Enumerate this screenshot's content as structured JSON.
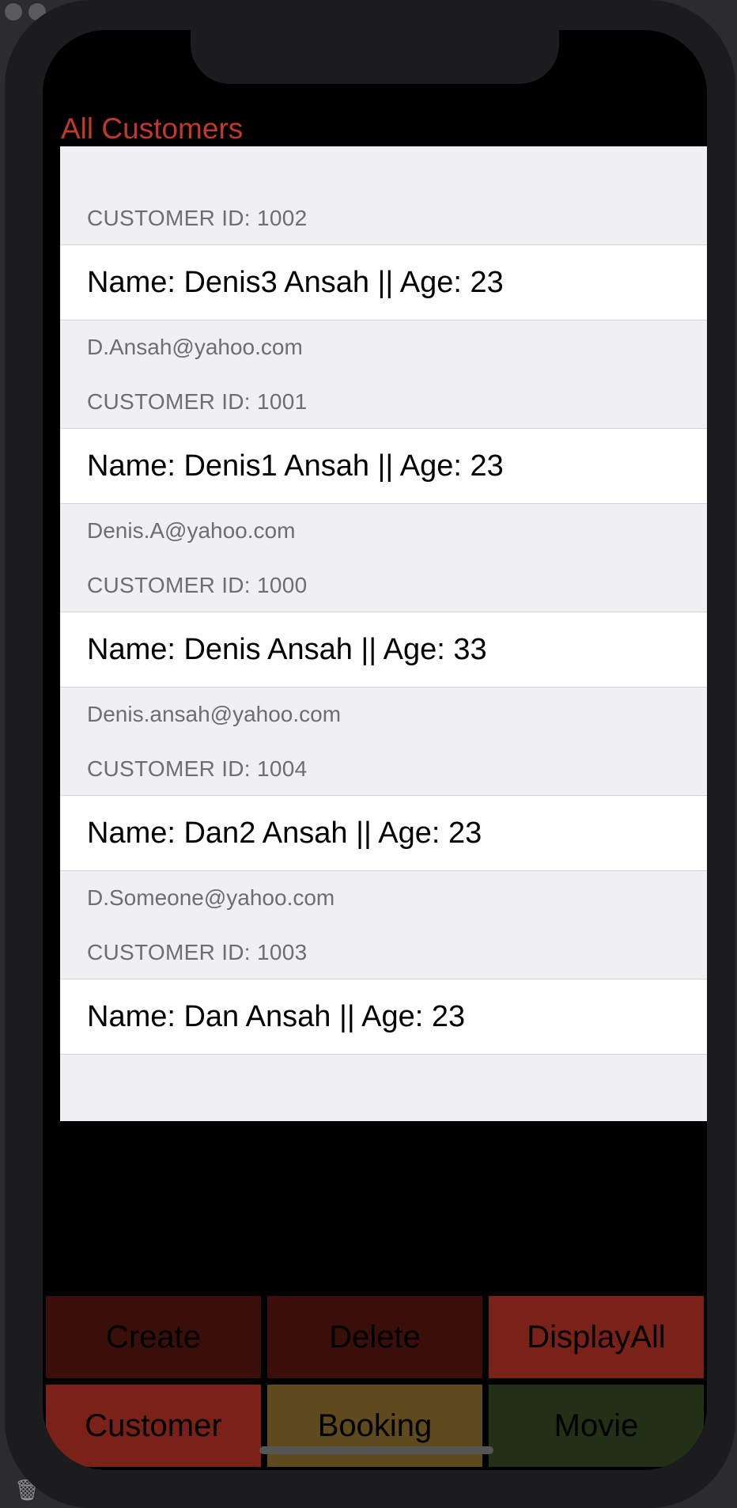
{
  "nav": {
    "title": "All Customers"
  },
  "customers": [
    {
      "header": "CUSTOMER ID: 1002",
      "row": "Name: Denis3  Ansah || Age: 23",
      "footer": "D.Ansah@yahoo.com"
    },
    {
      "header": "CUSTOMER ID: 1001",
      "row": "Name: Denis1  Ansah || Age: 23",
      "footer": "Denis.A@yahoo.com"
    },
    {
      "header": "CUSTOMER ID: 1000",
      "row": "Name: Denis  Ansah || Age: 33",
      "footer": "Denis.ansah@yahoo.com"
    },
    {
      "header": "CUSTOMER ID: 1004",
      "row": "Name: Dan2  Ansah || Age: 23",
      "footer": "D.Someone@yahoo.com"
    },
    {
      "header": "CUSTOMER ID: 1003",
      "row": "Name: Dan  Ansah || Age: 23",
      "footer": ""
    }
  ],
  "actions": {
    "create": "Create",
    "delete": "Delete",
    "display_all": "DisplayAll"
  },
  "tabs": {
    "customer": "Customer",
    "booking": "Booking",
    "movie": "Movie"
  },
  "colors": {
    "accent": "#c0392b",
    "create_bg": "#3a0f0a",
    "delete_bg": "#3a0f0a",
    "display_all_bg": "#7a2118",
    "customer_bg": "#7a2118",
    "booking_bg": "#5e4a1c",
    "movie_bg": "#223015"
  },
  "icons": {
    "trash": "trash-icon"
  }
}
